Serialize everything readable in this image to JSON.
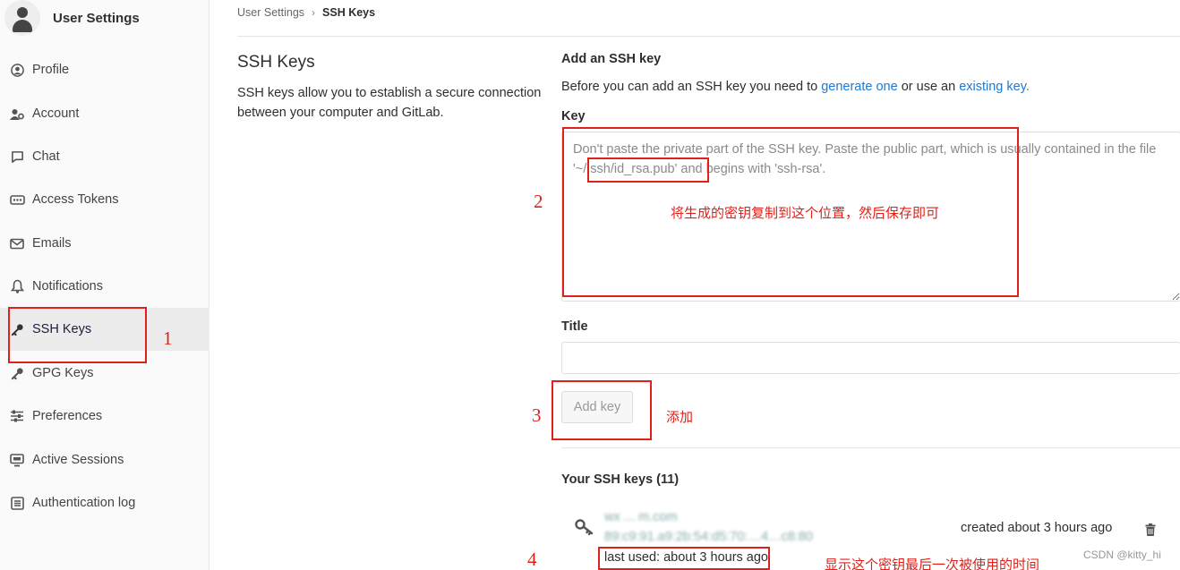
{
  "sidebar": {
    "title": "User Settings",
    "items": [
      {
        "label": "Profile",
        "icon": "profile-icon"
      },
      {
        "label": "Account",
        "icon": "account-gears-icon"
      },
      {
        "label": "Chat",
        "icon": "chat-icon"
      },
      {
        "label": "Access Tokens",
        "icon": "access-tokens-icon"
      },
      {
        "label": "Emails",
        "icon": "envelope-icon"
      },
      {
        "label": "Notifications",
        "icon": "bell-icon"
      },
      {
        "label": "SSH Keys",
        "icon": "key-icon",
        "active": true
      },
      {
        "label": "GPG Keys",
        "icon": "key-icon"
      },
      {
        "label": "Preferences",
        "icon": "sliders-icon"
      },
      {
        "label": "Active Sessions",
        "icon": "monitor-icon"
      },
      {
        "label": "Authentication log",
        "icon": "list-icon"
      }
    ]
  },
  "breadcrumb": {
    "parent": "User Settings",
    "current": "SSH Keys"
  },
  "section": {
    "title": "SSH Keys",
    "description": "SSH keys allow you to establish a secure connection between your computer and GitLab."
  },
  "form": {
    "title": "Add an SSH key",
    "intro_prefix": "Before you can add an SSH key you need to",
    "link_generate": "generate one",
    "intro_middle": "or use an",
    "link_existing": "existing key.",
    "key_label": "Key",
    "key_placeholder": "Don't paste the private part of the SSH key. Paste the public part, which is usually contained in the file '~/.ssh/id_rsa.pub' and begins with 'ssh-rsa'.",
    "title_label": "Title",
    "title_value": "",
    "add_button": "Add key"
  },
  "keys_list": {
    "heading": "Your SSH keys (11)",
    "items": [
      {
        "name": "wx … m.com",
        "fingerprint": "89:c9:91.a9:2b:54:d5:70:…4…c8:80",
        "last_used": "last used: about 3 hours ago",
        "created": "created about 3 hours ago"
      }
    ]
  },
  "annotations": {
    "n1": "1",
    "n2": "2",
    "n3": "3",
    "n4": "4",
    "text_key": "将生成的密钥复制到这个位置，然后保存即可",
    "text_add": "添加",
    "text_last_used": "显示这个密钥最后一次被使用的时间",
    "color": "#e0201a"
  },
  "watermark": "CSDN @kitty_hi",
  "colors": {
    "link": "#1f78d1",
    "sidebar_bg": "#fafafa",
    "active_bg": "#ececec"
  }
}
